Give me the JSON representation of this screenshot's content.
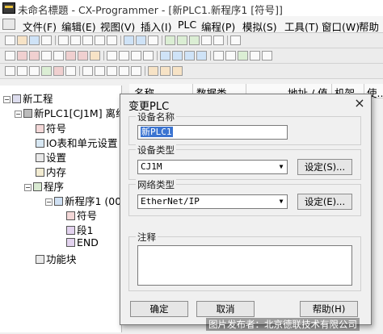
{
  "window": {
    "title": "未命名標題 - CX-Programmer - [新PLC1.新程序1 [符号]]"
  },
  "menu": [
    "文件(F)",
    "编辑(E)",
    "视图(V)",
    "插入(I)",
    "PLC",
    "编程(P)",
    "模拟(S)",
    "工具(T)",
    "窗口(W)",
    "帮助"
  ],
  "tree": {
    "root": "新工程",
    "plc": "新PLC1[CJ1M] 离线",
    "children": [
      "符号",
      "IO表和单元设置",
      "设置",
      "内存",
      "程序"
    ],
    "program": "新程序1 (00)",
    "program_children": [
      "符号",
      "段1",
      "END"
    ],
    "function_blocks": "功能块"
  },
  "list_columns": [
    "名称",
    "数据类...",
    "地址 / 值",
    "机架...",
    "使..."
  ],
  "dialog": {
    "title": "变更PLC",
    "close": "×",
    "device_name_label": "设备名称",
    "device_name_value": "新PLC1",
    "device_type_label": "设备类型",
    "device_type_value": "CJ1M",
    "device_settings_button": "设定(S)...",
    "network_type_label": "网络类型",
    "network_type_value": "EtherNet/IP",
    "network_settings_button": "设定(E)...",
    "comment_label": "注释",
    "comment_value": "",
    "ok_button": "确定",
    "cancel_button": "取消",
    "help_button": "帮助(H)"
  },
  "watermark": "图片发布者：北京德联技术有限公司"
}
